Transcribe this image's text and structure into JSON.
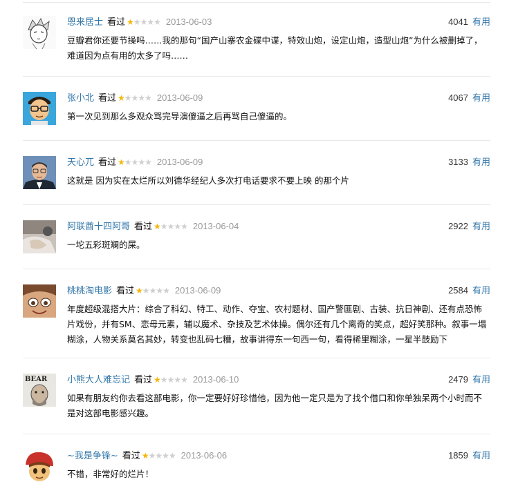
{
  "watched_label": "看过",
  "useful_label": "有用",
  "colors": {
    "link": "#3377aa",
    "star": "#f5b70a",
    "star_empty": "#cfcfcf",
    "date": "#999999"
  },
  "reviews": [
    {
      "user": "恩来居士",
      "rating": 1,
      "max_rating": 5,
      "date": "2013-06-03",
      "votes": "4041",
      "avatar_icon": "sketch-anime-avatar-icon",
      "content": "豆瓣君你还要节操吗……我的那句“国产山寨农金碟中谍，特效山炮，设定山炮，造型山炮”为什么被删掉了，难道因为点有用的太多了吗……"
    },
    {
      "user": "张小北",
      "rating": 1,
      "max_rating": 5,
      "date": "2013-06-09",
      "votes": "4067",
      "avatar_icon": "cartoon-glasses-man-avatar-icon",
      "content": "第一次见到那么多观众骂完导演傻逼之后再骂自己傻逼的。"
    },
    {
      "user": "天心兀",
      "rating": 1,
      "max_rating": 5,
      "date": "2013-06-09",
      "votes": "3133",
      "avatar_icon": "man-portrait-glasses-avatar-icon",
      "content": "这就是 因为实在太烂所以刘德华经纪人多次打电话要求不要上映 的那个片"
    },
    {
      "user": "阿联酋十四阿哥",
      "rating": 1,
      "max_rating": 5,
      "date": "2013-06-04",
      "votes": "2922",
      "avatar_icon": "photo-avatar-icon",
      "content": "一坨五彩斑斓的屎。"
    },
    {
      "user": "桃桃淘电影",
      "rating": 1,
      "max_rating": 5,
      "date": "2013-06-09",
      "votes": "2584",
      "avatar_icon": "anime-girl-avatar-icon",
      "content": "年度超级混搭大片：综合了科幻、特工、动作、夺宝、农村题材、国产警匪剧、古装、抗日神剧、还有点恐怖片戏份，并有SM、恋母元素，辅以魔术、杂技及艺术体操。偶尔还有几个离奇的笑点，超好笑那种。叙事一塌糊涂，人物关系莫名其妙，转变也乱码七糟，故事讲得东一句西一句，看得稀里糊涂，一星半鼓励下"
    },
    {
      "user": "小熊大人难忘记",
      "rating": 1,
      "max_rating": 5,
      "date": "2013-06-10",
      "votes": "2479",
      "avatar_icon": "bear-badge-avatar-icon",
      "avatar_text": "BEAR",
      "content": "如果有朋友约你去看这部电影，你一定要好好珍惜他，因为他一定只是为了找个借口和你单独呆两个小时而不是对这部电影感兴趣。"
    },
    {
      "user": "~我是争锋~",
      "rating": 1,
      "max_rating": 5,
      "date": "2013-06-06",
      "votes": "1859",
      "avatar_icon": "cartoon-red-hat-avatar-icon",
      "content": "不错，非常好的烂片！"
    }
  ]
}
